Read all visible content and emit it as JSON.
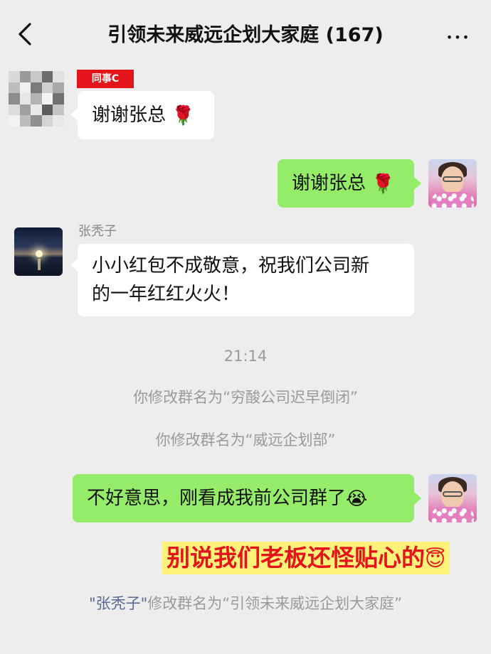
{
  "header": {
    "title": "引领未来威远企划大家庭 (167)",
    "back_icon": "chevron-left-icon",
    "more_icon": "more-dots-icon",
    "more_label": "•••"
  },
  "messages": [
    {
      "side": "left",
      "sender_tag": "同事C",
      "text": "谢谢张总",
      "emoji": "🌹"
    },
    {
      "side": "right",
      "text": "谢谢张总",
      "emoji": "🌹"
    },
    {
      "side": "left",
      "sender_name": "张秃子",
      "line1": "小小红包不成敬意，祝我们公司新",
      "line2": "的一年红红火火！"
    }
  ],
  "system": {
    "timestamp": "21:14",
    "notice1": "你修改群名为“穷酸公司迟早倒闭”",
    "notice2": "你修改群名为“威远企划部”",
    "notice3_name": "\"张秃子\"",
    "notice3_rest": "修改群名为“引领未来威远企划大家庭”"
  },
  "reply": {
    "text": "不好意思，刚看成我前公司群了",
    "emoji": "😭"
  },
  "caption": {
    "text": "别说我们老板还怪贴心的",
    "emoji": "😇"
  },
  "colors": {
    "background": "#ededed",
    "green_bubble": "#95ec69",
    "white_bubble": "#ffffff",
    "tag_red": "#e5141b",
    "caption_highlight": "#fff27a",
    "link_blue": "#576b95"
  }
}
